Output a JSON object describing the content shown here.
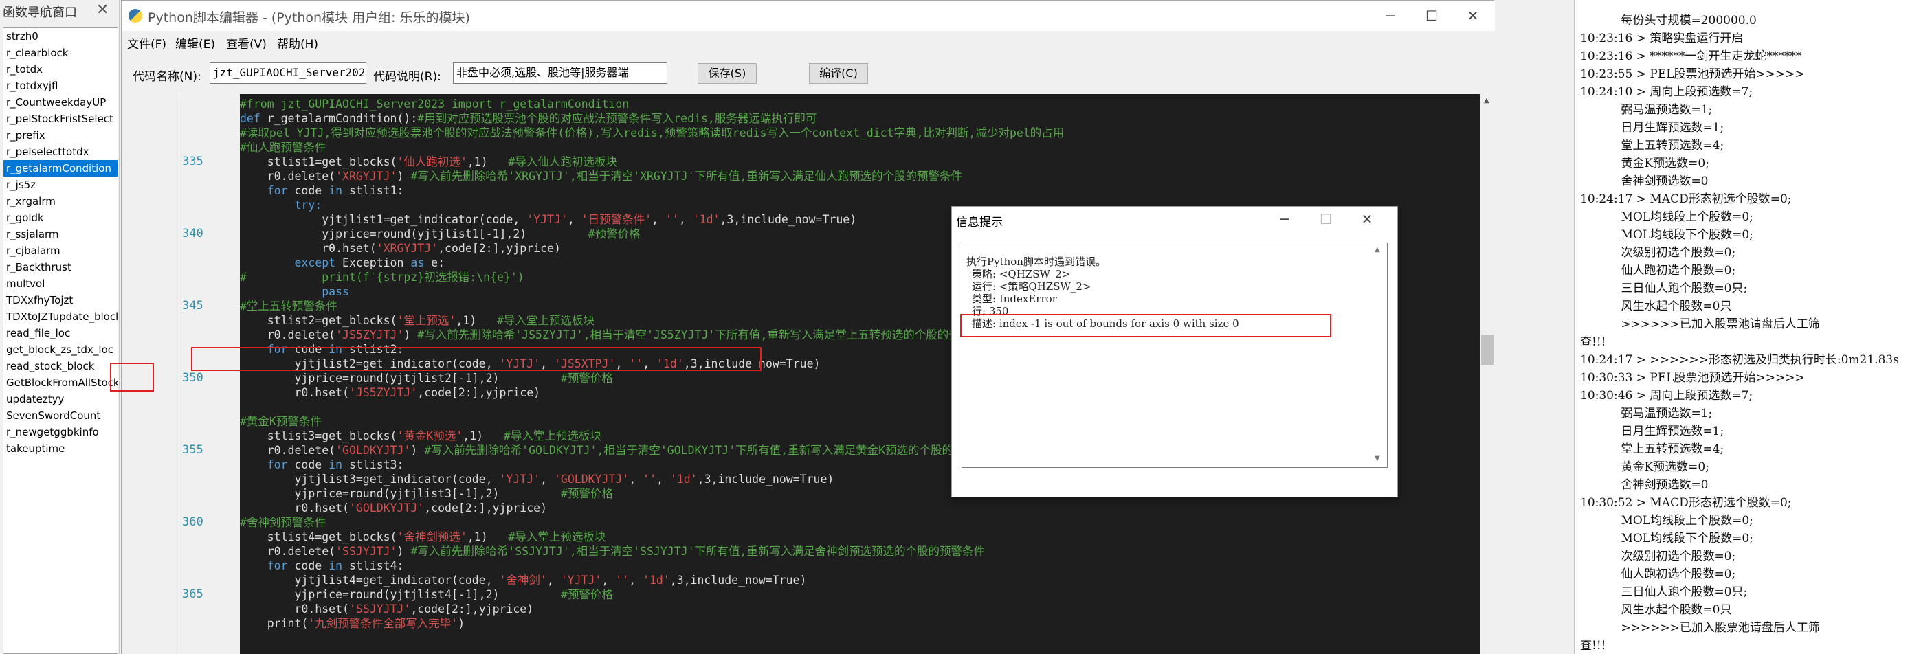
{
  "nav": {
    "title": "函数导航窗口",
    "items": [
      "strzh0",
      "r_clearblock",
      "r_totdx",
      "r_totdxyjfl",
      "r_CountweekdayUP",
      "r_pelStockFristSelect",
      "r_prefix",
      "r_pelselecttotdx",
      "r_getalarmCondition",
      "r_js5z",
      "r_xrgalrm",
      "r_goldk",
      "r_ssjalarm",
      "r_cjbalarm",
      "r_Backthrust",
      "multvol",
      "TDXxfhyTojzt",
      "TDXtoJZTupdate_block",
      "read_file_loc",
      "get_block_zs_tdx_loc",
      "read_stock_block",
      "GetBlockFromAllStock",
      "updateztyy",
      "SevenSwordCount",
      "r_newgetggbkinfo",
      "takeuptime"
    ],
    "selected_index": 8
  },
  "editor": {
    "title": "Python脚本编辑器 - (Python模块 用户组: 乐乐的模块)",
    "menu": [
      "文件(F)",
      "编辑(E)",
      "查看(V)",
      "帮助(H)"
    ],
    "code_name_label": "代码名称(N):",
    "code_name_value": "jzt_GUPIAOCHI_Server2023",
    "code_desc_label": "代码说明(R):",
    "code_desc_value": "非盘中必须,选股、股池等|服务器端",
    "save_label": "保存(S)",
    "compile_label": "编译(C)",
    "line_numbers": [
      "335",
      "340",
      "345",
      "350",
      "355",
      "360",
      "365"
    ],
    "code_lines": [
      [
        [
          "c",
          "#from jzt_GUPIAOCHI_Server2023 import r_getalarmCondition"
        ]
      ],
      [
        [
          "k",
          "def "
        ],
        [
          "t",
          "r_getalarmCondition():"
        ],
        [
          "c",
          "#用到对应预选股票池个股的对应战法预警条件写入redis,服务器远端执行即可"
        ]
      ],
      [
        [
          "c",
          "#读取pel_YJTJ,得到对应预选股票池个股的对应战法预警条件(价格),写入redis,预警策略读取redis写入一个context_dict字典,比对判断,减少对pel的占用"
        ]
      ],
      [
        [
          "c",
          "#仙人跑预警条件"
        ]
      ],
      [
        [
          "t",
          "    stlist1=get_blocks("
        ],
        [
          "s",
          "'仙人跑初选'"
        ],
        [
          "t",
          ",1)   "
        ],
        [
          "c",
          "#导入仙人跑初选板块"
        ]
      ],
      [
        [
          "t",
          "    r0.delete("
        ],
        [
          "s",
          "'XRGYJTJ'"
        ],
        [
          "t",
          ") "
        ],
        [
          "c",
          "#写入前先删除哈希'XRGYJTJ',相当于清空'XRGYJTJ'下所有值,重新写入满足仙人跑预选的个股的预警条件"
        ]
      ],
      [
        [
          "k",
          "    for "
        ],
        [
          "t",
          "code "
        ],
        [
          "k",
          "in "
        ],
        [
          "t",
          "stlist1:"
        ]
      ],
      [
        [
          "k",
          "        try:"
        ]
      ],
      [
        [
          "t",
          "            yjtjlist1=get_indicator(code, "
        ],
        [
          "s",
          "'YJTJ'"
        ],
        [
          "t",
          ", "
        ],
        [
          "s",
          "'日预警条件'"
        ],
        [
          "t",
          ", "
        ],
        [
          "s",
          "''"
        ],
        [
          "t",
          ", "
        ],
        [
          "s",
          "'1d'"
        ],
        [
          "t",
          ",3,include_now=True)"
        ]
      ],
      [
        [
          "t",
          "            yjprice=round(yjtjlist1[-1],2)         "
        ],
        [
          "c",
          "#预警价格"
        ]
      ],
      [
        [
          "t",
          "            r0.hset("
        ],
        [
          "s",
          "'XRGYJTJ'"
        ],
        [
          "t",
          ",code[2:],yjprice)"
        ]
      ],
      [
        [
          "k",
          "        except "
        ],
        [
          "t",
          "Exception "
        ],
        [
          "k",
          "as "
        ],
        [
          "t",
          "e:"
        ]
      ],
      [
        [
          "c",
          "#           print(f'{strpz}初选报错:\\n{e}')"
        ]
      ],
      [
        [
          "k",
          "            pass"
        ]
      ],
      [
        [
          "c",
          "#堂上五转预警条件"
        ]
      ],
      [
        [
          "t",
          "    stlist2=get_blocks("
        ],
        [
          "s",
          "'堂上预选'"
        ],
        [
          "t",
          ",1)   "
        ],
        [
          "c",
          "#导入堂上预选板块"
        ]
      ],
      [
        [
          "t",
          "    r0.delete("
        ],
        [
          "s",
          "'JS5ZYJTJ'"
        ],
        [
          "t",
          ") "
        ],
        [
          "c",
          "#写入前先删除哈希'JS5ZYJTJ',相当于清空'JS5ZYJTJ'下所有值,重新写入满足堂上五转预选的个股的预警条件"
        ]
      ],
      [
        [
          "k",
          "    for "
        ],
        [
          "t",
          "code "
        ],
        [
          "k",
          "in "
        ],
        [
          "t",
          "stlist2:"
        ]
      ],
      [
        [
          "t",
          "        yjtjlist2=get_indicator(code, "
        ],
        [
          "s",
          "'YJTJ'"
        ],
        [
          "t",
          ", "
        ],
        [
          "s",
          "'JS5XTPJ'"
        ],
        [
          "t",
          ", "
        ],
        [
          "s",
          "''"
        ],
        [
          "t",
          ", "
        ],
        [
          "s",
          "'1d'"
        ],
        [
          "t",
          ",3,include_now=True)"
        ]
      ],
      [
        [
          "t",
          "        yjprice=round(yjtjlist2[-1],2)         "
        ],
        [
          "c",
          "#预警价格"
        ]
      ],
      [
        [
          "t",
          "        r0.hset("
        ],
        [
          "s",
          "'JS5ZYJTJ'"
        ],
        [
          "t",
          ",code[2:],yjprice)"
        ]
      ],
      [
        [
          "t",
          ""
        ]
      ],
      [
        [
          "c",
          "#黄金K预警条件"
        ]
      ],
      [
        [
          "t",
          "    stlist3=get_blocks("
        ],
        [
          "s",
          "'黄金K预选'"
        ],
        [
          "t",
          ",1)   "
        ],
        [
          "c",
          "#导入堂上预选板块"
        ]
      ],
      [
        [
          "t",
          "    r0.delete("
        ],
        [
          "s",
          "'GOLDKYJTJ'"
        ],
        [
          "t",
          ") "
        ],
        [
          "c",
          "#写入前先删除哈希'GOLDKYJTJ',相当于清空'GOLDKYJTJ'下所有值,重新写入满足黄金K预选的个股的预警条件"
        ]
      ],
      [
        [
          "k",
          "    for "
        ],
        [
          "t",
          "code "
        ],
        [
          "k",
          "in "
        ],
        [
          "t",
          "stlist3:"
        ]
      ],
      [
        [
          "t",
          "        yjtjlist3=get_indicator(code, "
        ],
        [
          "s",
          "'YJTJ'"
        ],
        [
          "t",
          ", "
        ],
        [
          "s",
          "'GOLDKYJTJ'"
        ],
        [
          "t",
          ", "
        ],
        [
          "s",
          "''"
        ],
        [
          "t",
          ", "
        ],
        [
          "s",
          "'1d'"
        ],
        [
          "t",
          ",3,include_now=True)"
        ]
      ],
      [
        [
          "t",
          "        yjprice=round(yjtjlist3[-1],2)         "
        ],
        [
          "c",
          "#预警价格"
        ]
      ],
      [
        [
          "t",
          "        r0.hset("
        ],
        [
          "s",
          "'GOLDKYJTJ'"
        ],
        [
          "t",
          ",code[2:],yjprice)"
        ]
      ],
      [
        [
          "c",
          "#舍神剑预警条件"
        ]
      ],
      [
        [
          "t",
          "    stlist4=get_blocks("
        ],
        [
          "s",
          "'舍神剑预选'"
        ],
        [
          "t",
          ",1)   "
        ],
        [
          "c",
          "#导入堂上预选板块"
        ]
      ],
      [
        [
          "t",
          "    r0.delete("
        ],
        [
          "s",
          "'SSJYJTJ'"
        ],
        [
          "t",
          ") "
        ],
        [
          "c",
          "#写入前先删除哈希'SSJYJTJ',相当于清空'SSJYJTJ'下所有值,重新写入满足舍神剑预选预选的个股的预警条件"
        ]
      ],
      [
        [
          "k",
          "    for "
        ],
        [
          "t",
          "code "
        ],
        [
          "k",
          "in "
        ],
        [
          "t",
          "stlist4:"
        ]
      ],
      [
        [
          "t",
          "        yjtjlist4=get_indicator(code, "
        ],
        [
          "s",
          "'舍神剑'"
        ],
        [
          "t",
          ", "
        ],
        [
          "s",
          "'YJTJ'"
        ],
        [
          "t",
          ", "
        ],
        [
          "s",
          "''"
        ],
        [
          "t",
          ", "
        ],
        [
          "s",
          "'1d'"
        ],
        [
          "t",
          ",3,include_now=True)"
        ]
      ],
      [
        [
          "t",
          "        yjprice=round(yjtjlist4[-1],2)         "
        ],
        [
          "c",
          "#预警价格"
        ]
      ],
      [
        [
          "t",
          "        r0.hset("
        ],
        [
          "s",
          "'SSJYJTJ'"
        ],
        [
          "t",
          ",code[2:],yjprice)"
        ]
      ],
      [
        [
          "t",
          "    print("
        ],
        [
          "s",
          "'九剑预警条件全部写入完毕'"
        ],
        [
          "t",
          ")"
        ]
      ]
    ]
  },
  "dialog": {
    "title": "信息提示",
    "lines": [
      "执行Python脚本时遇到错误。",
      "策略: <QHZSW_2>",
      "运行: <策略QHZSW_2>",
      "类型: IndexError",
      "行: 350",
      "描述: index -1 is out of bounds for axis 0 with size 0"
    ]
  },
  "log": {
    "lines": [
      "",
      "           每份头寸规模=200000.0",
      "10:23:16 > 策略实盘运行开启",
      "10:23:16 > ******一剑开生走龙蛇******",
      "10:23:55 > PEL股票池预选开始>>>>>",
      "10:24:10 > 周向上段预选数=7;",
      "           弼马温预选数=1;",
      "           日月生辉预选数=1;",
      "           堂上五转预选数=4;",
      "           黄金K预选数=0;",
      "           舍神剑预选数=0",
      "10:24:17 > MACD形态初选个股数=0;",
      "           MOL均线段上个股数=0;",
      "           MOL均线段下个股数=0;",
      "           次级别初选个股数=0;",
      "           仙人跑初选个股数=0;",
      "           三日仙人跑个股数=0只;",
      "           风生水起个股数=0只",
      "           >>>>>>已加入股票池请盘后人工筛",
      "查!!!",
      "10:24:17 > >>>>>>形态初选及归类执行时长:0m21.83s",
      "10:30:33 > PEL股票池预选开始>>>>>",
      "10:30:46 > 周向上段预选数=7;",
      "           弼马温预选数=1;",
      "           日月生辉预选数=1;",
      "           堂上五转预选数=4;",
      "           黄金K预选数=0;",
      "           舍神剑预选数=0",
      "10:30:52 > MACD形态初选个股数=0;",
      "           MOL均线段上个股数=0;",
      "           MOL均线段下个股数=0;",
      "           次级别初选个股数=0;",
      "           仙人跑初选个股数=0;",
      "           三日仙人跑个股数=0只;",
      "           风生水起个股数=0只",
      "           >>>>>>已加入股票池请盘后人工筛",
      "查!!!"
    ]
  },
  "colors": {
    "code_bg": "#1e1e1e",
    "comment": "#57a64a",
    "keyword": "#569cd6",
    "string": "#d65050",
    "plain": "#dcdcdc",
    "line_number": "#2b91af",
    "highlight_box": "#e02020",
    "selected_item": "#0078d7"
  }
}
